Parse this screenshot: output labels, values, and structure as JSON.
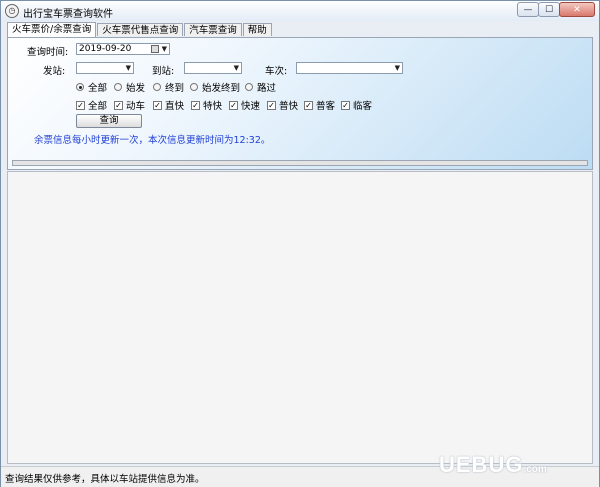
{
  "window": {
    "title": "出行宝车票查询软件",
    "app_icon": "clock-icon",
    "buttons": {
      "minimize": "—",
      "maximize": "☐",
      "close": "✕"
    }
  },
  "tabs": [
    {
      "label": "火车票价/余票查询",
      "active": true
    },
    {
      "label": "火车票代售点查询",
      "active": false
    },
    {
      "label": "汽车票查询",
      "active": false
    },
    {
      "label": "帮助",
      "active": false
    }
  ],
  "form": {
    "date_label": "查询时间:",
    "date_value": "2019-09-20",
    "from_label": "发站:",
    "from_value": "",
    "to_label": "到站:",
    "to_value": "",
    "train_label": "车次:",
    "train_value": "",
    "station_type_options": [
      {
        "label": "全部",
        "selected": true
      },
      {
        "label": "始发",
        "selected": false
      },
      {
        "label": "终到",
        "selected": false
      },
      {
        "label": "始发终到",
        "selected": false
      },
      {
        "label": "路过",
        "selected": false
      }
    ],
    "train_types": [
      {
        "label": "全部",
        "checked": true
      },
      {
        "label": "动车",
        "checked": true
      },
      {
        "label": "直快",
        "checked": true
      },
      {
        "label": "特快",
        "checked": true
      },
      {
        "label": "快速",
        "checked": true
      },
      {
        "label": "普快",
        "checked": true
      },
      {
        "label": "普客",
        "checked": true
      },
      {
        "label": "临客",
        "checked": true
      }
    ],
    "query_button": "查询",
    "info_text": "余票信息每小时更新一次，本次信息更新时间为12:32。",
    "progress": 0
  },
  "status_bar": {
    "text": "查询结果仅供参考，具体以车站提供信息为准。"
  },
  "watermark": {
    "text": "UEBUG",
    "suffix": ".com"
  }
}
